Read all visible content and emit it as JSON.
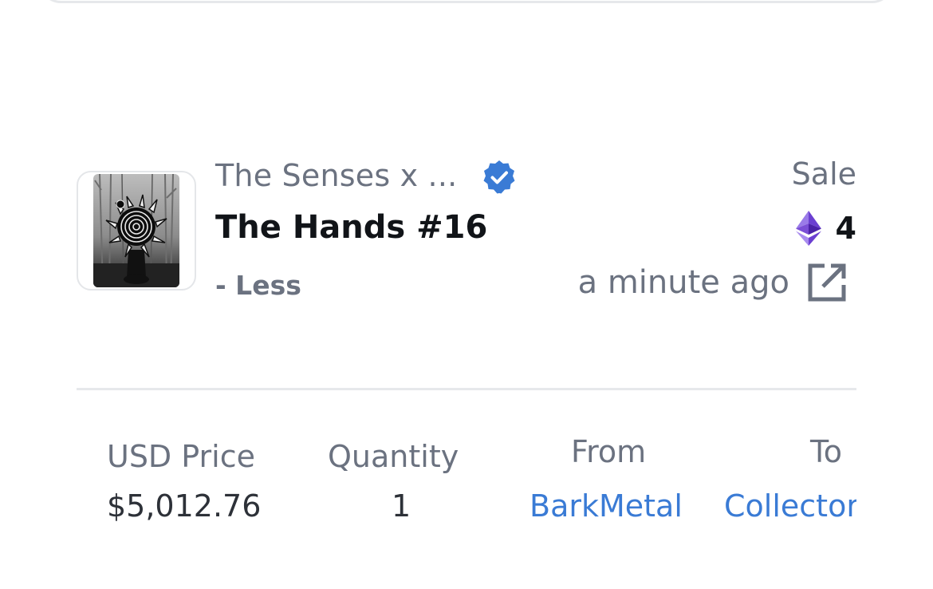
{
  "activity": {
    "collection_name": "The Senses x ...",
    "item_name": "The Hands #16",
    "toggle_label": "- Less",
    "event_type": "Sale",
    "price": "4",
    "price_currency_icon": "ethereum-icon",
    "time_ago": "a minute ago",
    "verified_icon": "verified-badge-icon",
    "link_icon": "external-link-icon",
    "colors": {
      "verified": "#3a7bd5",
      "link": "#3a7bd5",
      "muted_text": "#6b7280",
      "strong_text": "#111418",
      "eth_purple": "#7b4fd6"
    }
  },
  "details": {
    "usd_price_label": "USD Price",
    "usd_price_value": "$5,012.76",
    "quantity_label": "Quantity",
    "quantity_value": "1",
    "from_label": "From",
    "from_value": "BarkMetal",
    "to_label": "To",
    "to_value": "Collector"
  }
}
